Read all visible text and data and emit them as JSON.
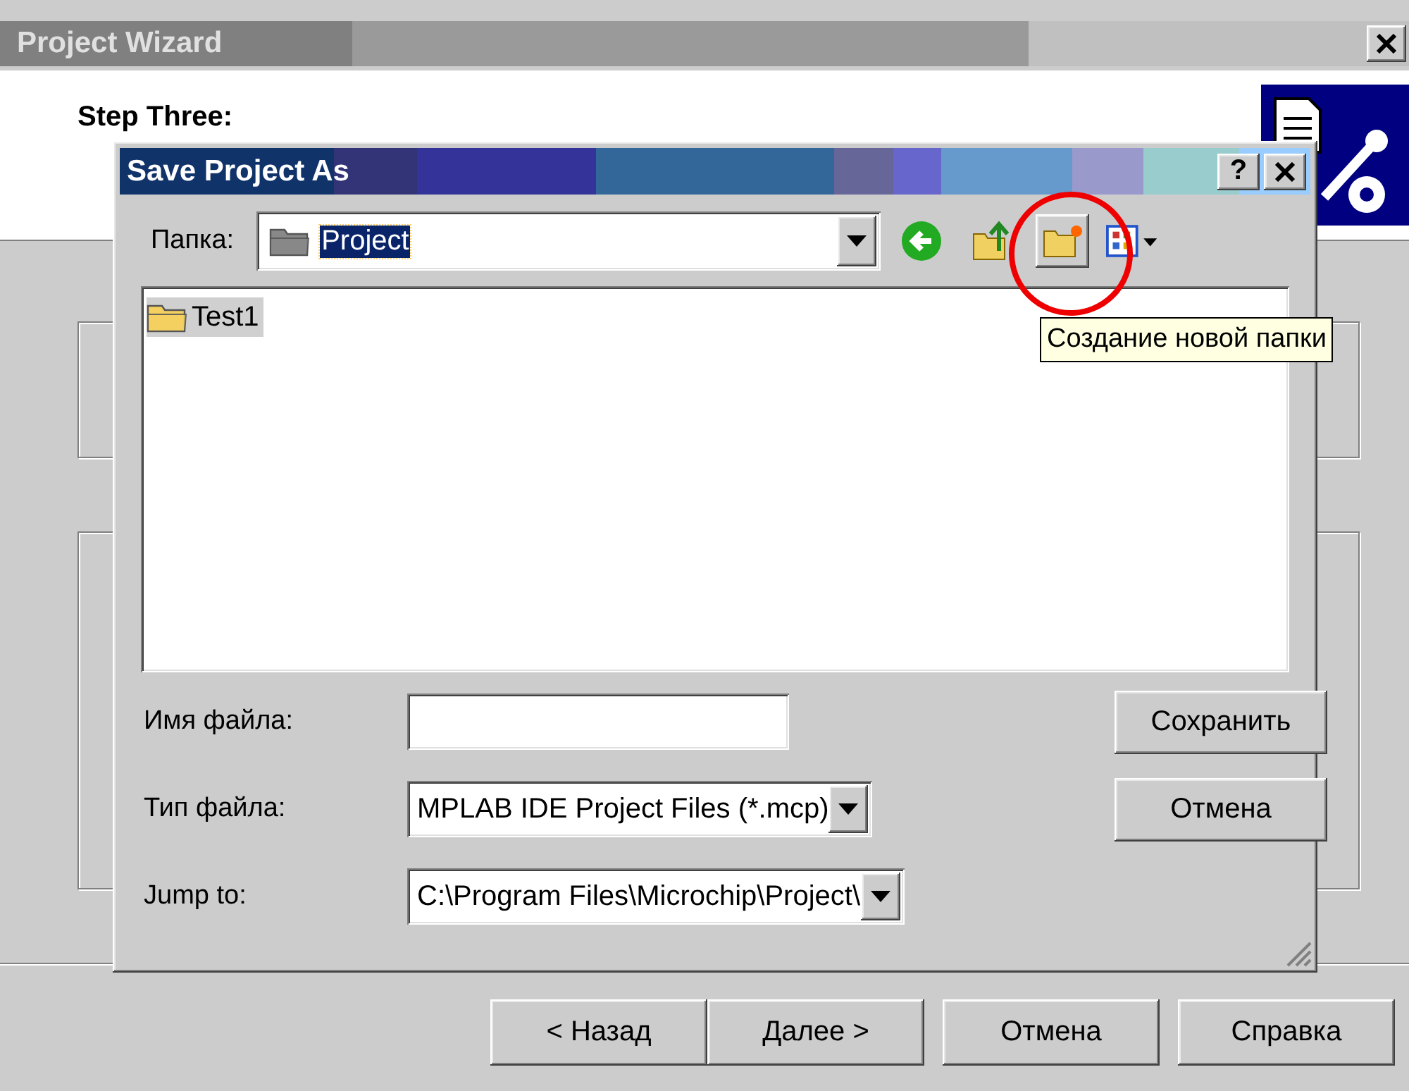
{
  "wizard": {
    "title": "Project Wizard",
    "step": "Step Three:",
    "buttons": [
      {
        "label": "< Назад"
      },
      {
        "label": "Далее >"
      },
      {
        "label": "Отмена"
      },
      {
        "label": "Справка"
      }
    ]
  },
  "dialog": {
    "title": "Save Project As",
    "help_button": "?",
    "folder_label": "Папка:",
    "folder": "Project",
    "files": [
      {
        "name": "Test1",
        "selected": true
      }
    ],
    "fields": [
      {
        "label": "Имя файла:",
        "kind": "text"
      },
      {
        "label": "Тип файла:",
        "kind": "combo",
        "value": "MPLAB IDE Project Files (*.mcp)"
      },
      {
        "label": "Jump to:",
        "kind": "combo",
        "value": "C:\\Program Files\\Microchip\\Project\\"
      }
    ],
    "buttons": [
      "Сохранить",
      "Отмена"
    ]
  },
  "tooltip": "Создание новой папки"
}
